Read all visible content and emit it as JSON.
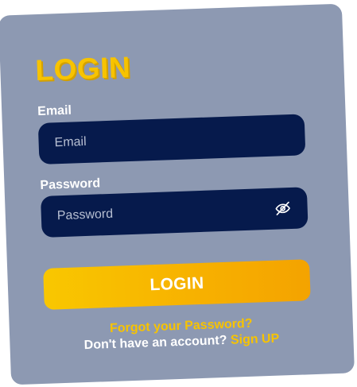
{
  "form": {
    "title": "LOGIN",
    "email_label": "Email",
    "email_placeholder": "Email",
    "password_label": "Password",
    "password_placeholder": "Password",
    "submit_label": "LOGIN",
    "forgot_label": "Forgot your Password?",
    "no_account_text": "Don't have an account?",
    "signup_label": "Sign UP"
  },
  "icons": {
    "password_toggle": "eye-off-icon"
  },
  "colors": {
    "card_bg": "#8d99b2",
    "input_bg": "#061a4c",
    "accent_yellow": "#f7c300",
    "button_gradient_start": "#f9c700",
    "button_gradient_end": "#f4a300",
    "text_white": "#ffffff"
  }
}
